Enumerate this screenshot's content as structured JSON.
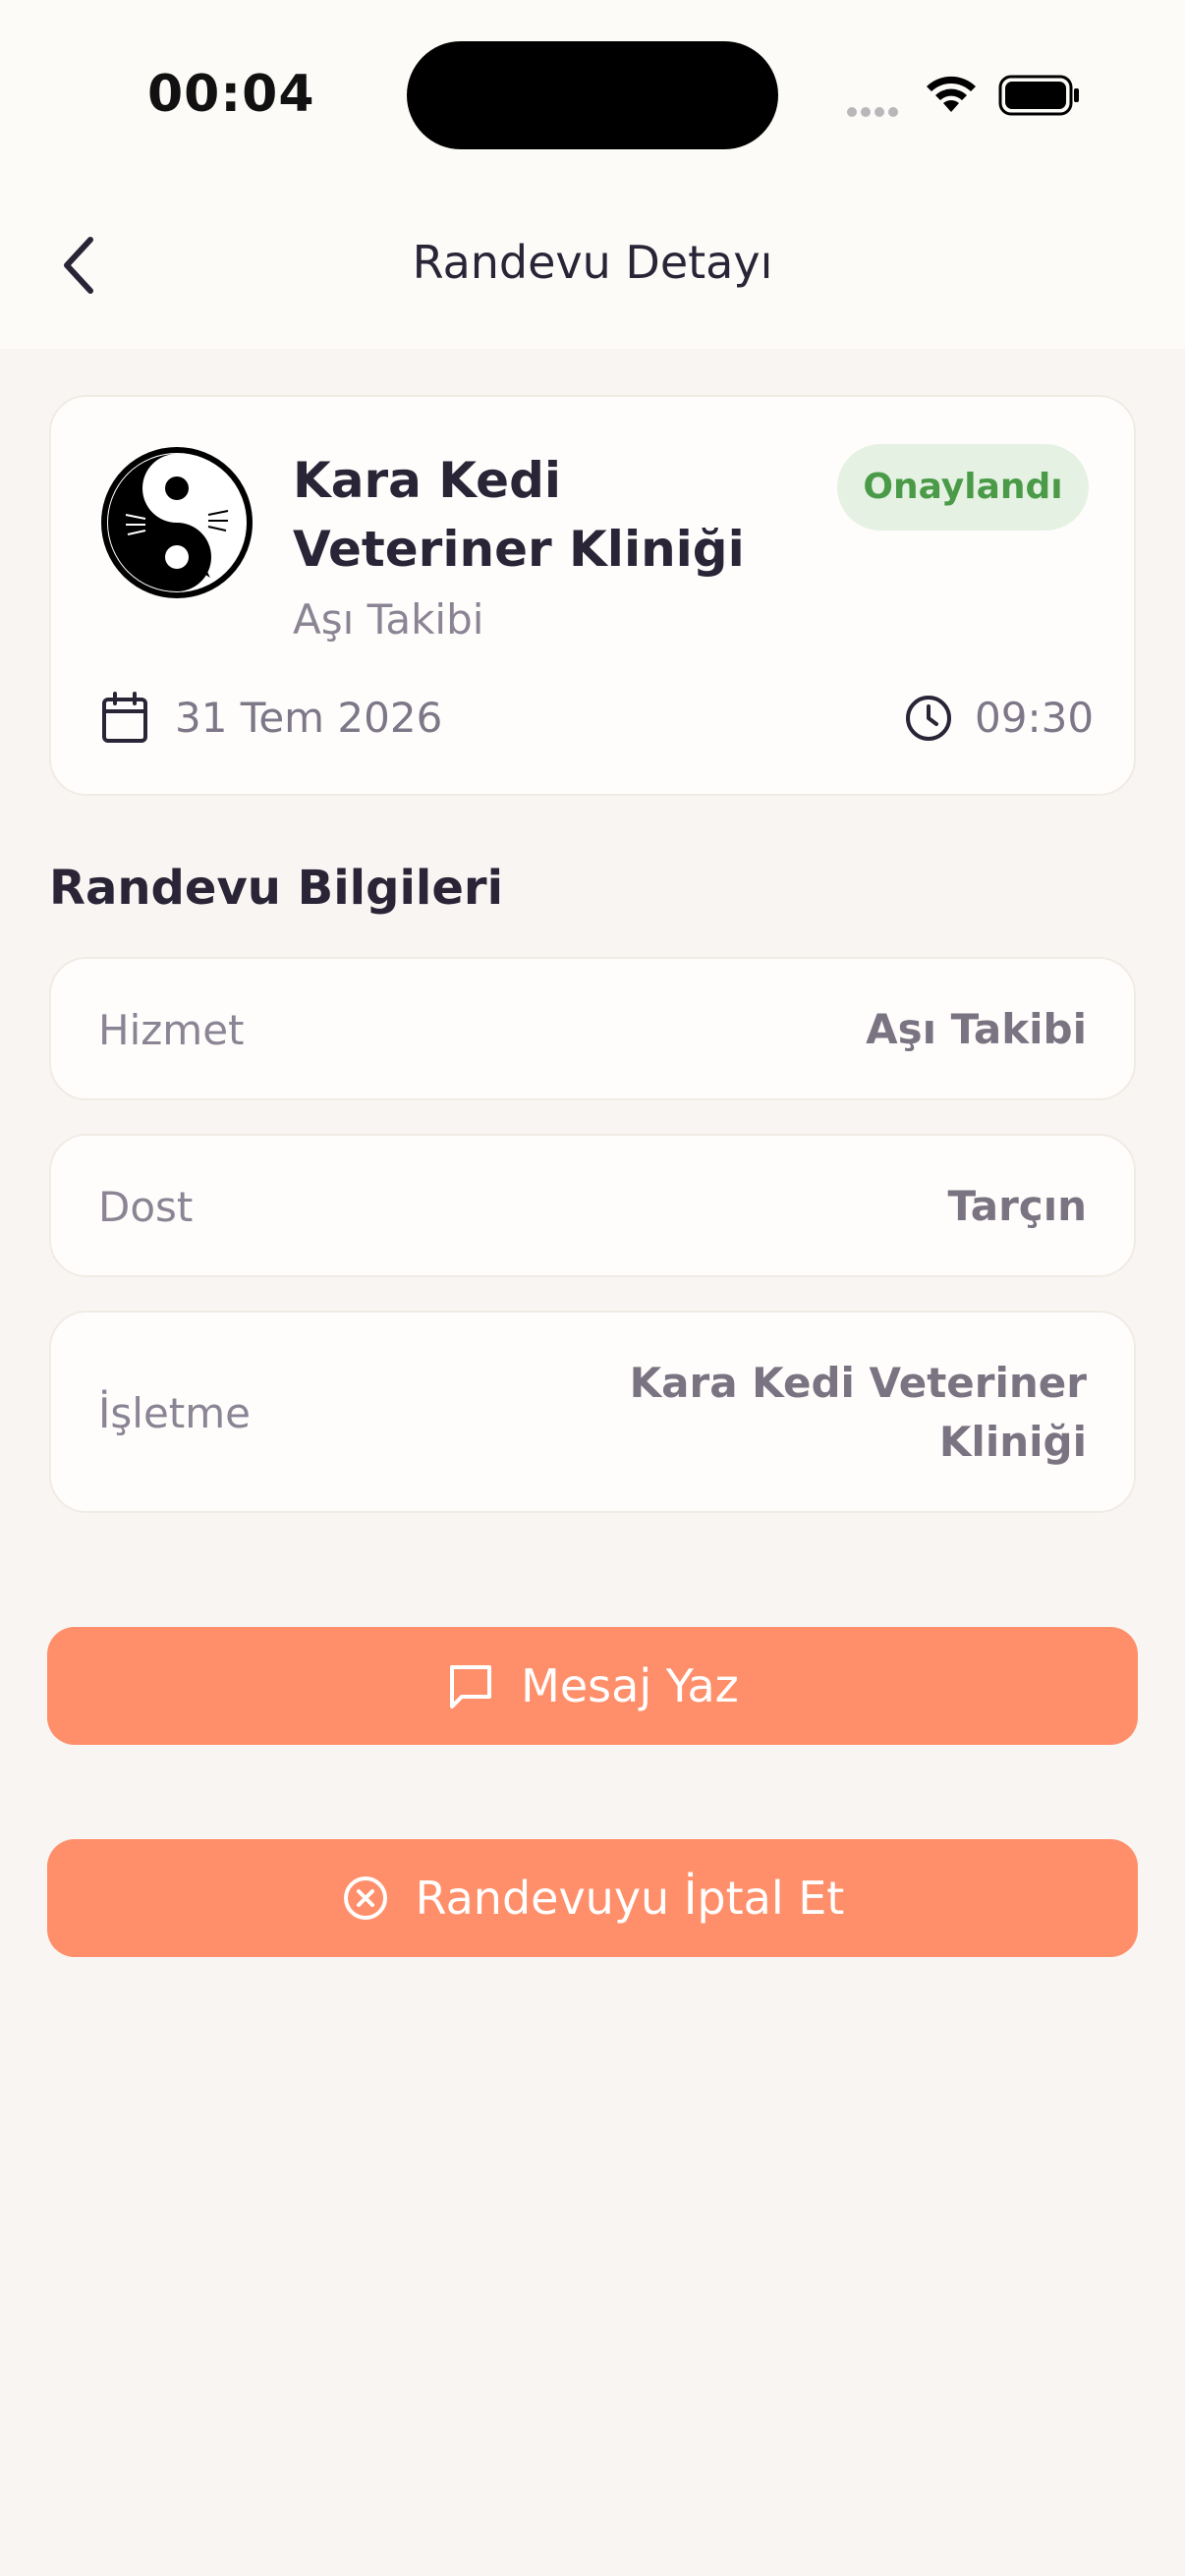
{
  "status_bar": {
    "time": "00:04"
  },
  "nav": {
    "title": "Randevu Detayı"
  },
  "appointment": {
    "clinic_name": "Kara Kedi Veteriner Kliniği",
    "service": "Aşı Takibi",
    "status": "Onaylandı",
    "date": "31 Tem 2026",
    "time": "09:30"
  },
  "details": {
    "title": "Randevu Bilgileri",
    "rows": [
      {
        "label": "Hizmet",
        "value": "Aşı Takibi"
      },
      {
        "label": "Dost",
        "value": "Tarçın"
      },
      {
        "label": "İşletme",
        "value": "Kara Kedi Veteriner Kliniği"
      }
    ]
  },
  "actions": {
    "message_label": "Mesaj Yaz",
    "cancel_label": "Randevuyu İptal Et"
  },
  "colors": {
    "accent": "#ff8f6a",
    "status_bg": "#e5f2e3",
    "status_text": "#4a9a48"
  }
}
